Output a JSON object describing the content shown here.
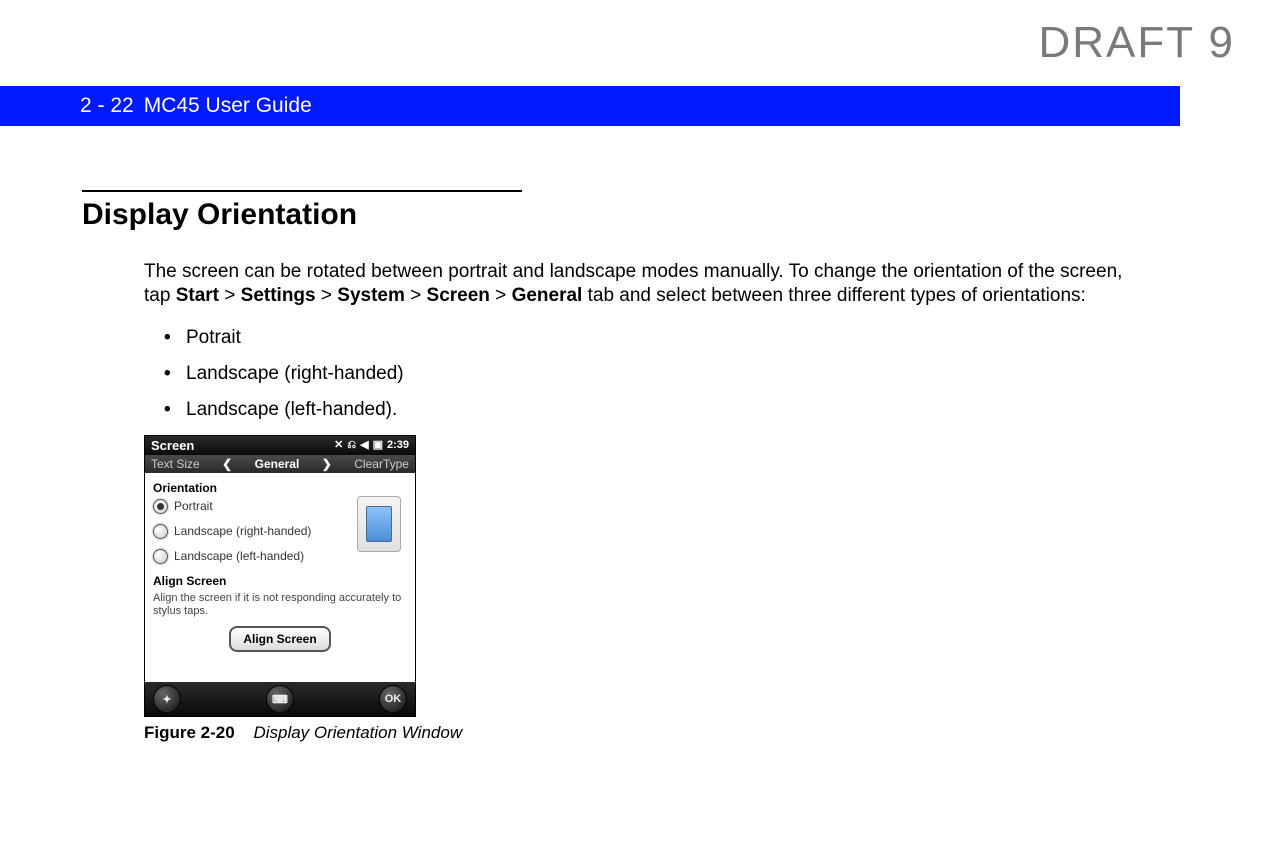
{
  "watermark": "DRAFT 9",
  "header": {
    "page_number": "2 - 22",
    "title": "MC45 User Guide"
  },
  "section": {
    "heading": "Display Orientation",
    "intro_before_path": "The screen can be rotated between portrait and landscape modes manually. To change the orientation of the screen, tap ",
    "path_start": "Start",
    "sep": " > ",
    "path_settings": "Settings",
    "path_system": "System",
    "path_screen": "Screen",
    "path_general": "General",
    "intro_after_path": " tab and select between three different types of orientations:",
    "bullets": [
      "Potrait",
      "Landscape (right-handed)",
      "Landscape (left-handed)."
    ]
  },
  "device": {
    "title": "Screen",
    "clock": "2:39",
    "tab_left": "Text Size",
    "tab_center": "General",
    "tab_right": "ClearType",
    "orientation_label": "Orientation",
    "radios": [
      {
        "label": "Portrait",
        "checked": true
      },
      {
        "label": "Landscape (right-handed)",
        "checked": false
      },
      {
        "label": "Landscape (left-handed)",
        "checked": false
      }
    ],
    "align_label": "Align Screen",
    "align_text": "Align the screen if it is not responding accurately to stylus taps.",
    "align_button": "Align Screen",
    "ok_label": "OK"
  },
  "figure": {
    "label": "Figure 2-20",
    "title": "Display Orientation Window"
  }
}
